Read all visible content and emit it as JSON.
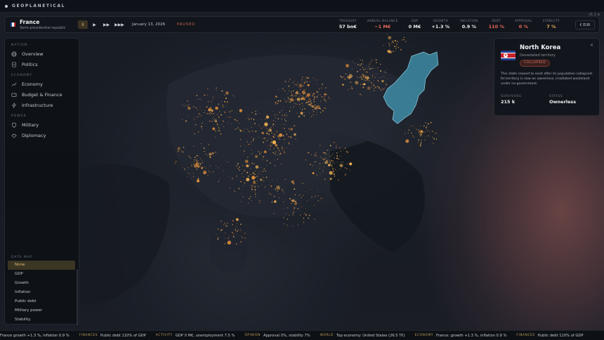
{
  "app": {
    "brand": "GEOPLANETICAL",
    "version": "v1.1 α"
  },
  "header": {
    "country_name": "France",
    "country_type": "Semi-presidential republic",
    "flag_colors": [
      "#1f4fa8",
      "#f2f2f2",
      "#d62b2b"
    ],
    "speed_controls": {
      "pause": "II",
      "play": "▶",
      "fast": "▶▶",
      "fastest": "▶▶▶"
    },
    "date": "January 13, 2026",
    "status": "PAUSED",
    "stats": [
      {
        "label": "TREASURY",
        "value": "57 bn€",
        "tone": ""
      },
      {
        "label": "ANNUAL BALANCE",
        "value": "−1 M€",
        "tone": "neg"
      },
      {
        "label": "GDP",
        "value": "0 M€",
        "tone": ""
      },
      {
        "label": "GROWTH",
        "value": "+1.3 %",
        "tone": ""
      },
      {
        "label": "INFLATION",
        "value": "0.9 %",
        "tone": ""
      },
      {
        "label": "DEBT",
        "value": "110 %",
        "tone": "neg"
      },
      {
        "label": "APPROVAL",
        "value": "0 %",
        "tone": "neg"
      },
      {
        "label": "STABILITY",
        "value": "7 %",
        "tone": "pos"
      }
    ],
    "currency": "€ EUR"
  },
  "sidebar": {
    "sections": [
      {
        "title": "NATION",
        "items": [
          {
            "label": "Overview",
            "icon": "globe-icon"
          },
          {
            "label": "Politics",
            "icon": "document-icon"
          }
        ]
      },
      {
        "title": "ECONOMY",
        "items": [
          {
            "label": "Economy",
            "icon": "chart-icon"
          },
          {
            "label": "Budget & Finance",
            "icon": "wallet-icon"
          },
          {
            "label": "Infrastructure",
            "icon": "bolt-icon"
          }
        ]
      },
      {
        "title": "POWER",
        "items": [
          {
            "label": "Military",
            "icon": "shield-icon"
          },
          {
            "label": "Diplomacy",
            "icon": "handshake-icon"
          }
        ]
      }
    ],
    "data_map": {
      "title": "DATA MAP",
      "items": [
        "None",
        "GDP",
        "Growth",
        "Inflation",
        "Public debt",
        "Military power",
        "Stability"
      ],
      "selected": "None"
    }
  },
  "panel": {
    "title": "North Korea",
    "subtitle": "Devastated territory",
    "badge": "COLLAPSED",
    "close": "×",
    "description": "This state ceased to exist after its population collapsed. Its territory is now an ownerless, irradiated wasteland under no government.",
    "survivors_label": "SURVIVORS",
    "survivors_value": "215 k",
    "status_label": "STATUS",
    "status_value": "Ownerless"
  },
  "ticker": [
    {
      "tag": "",
      "text": "France growth +1.3 %, inflation 0.9 %"
    },
    {
      "tag": "FINANCES",
      "text": "Public debt 110% of GDP"
    },
    {
      "tag": "ACTIVITY",
      "text": "GDP 0 M€, unemployment 7.5 %"
    },
    {
      "tag": "OPINION",
      "text": "Approval 0%, stability 7%"
    },
    {
      "tag": "WORLD",
      "text": "Top economy: United States (26.5 T€)"
    },
    {
      "tag": "ECONOMY",
      "text": "France: growth +1.3 %, inflation 0.9 %"
    },
    {
      "tag": "FINANCES",
      "text": "Public debt 110% of GDP"
    }
  ],
  "colors": {
    "accent": "#e3b870",
    "negative": "#e36a5a",
    "highlight_region": "#3f8fa8"
  }
}
